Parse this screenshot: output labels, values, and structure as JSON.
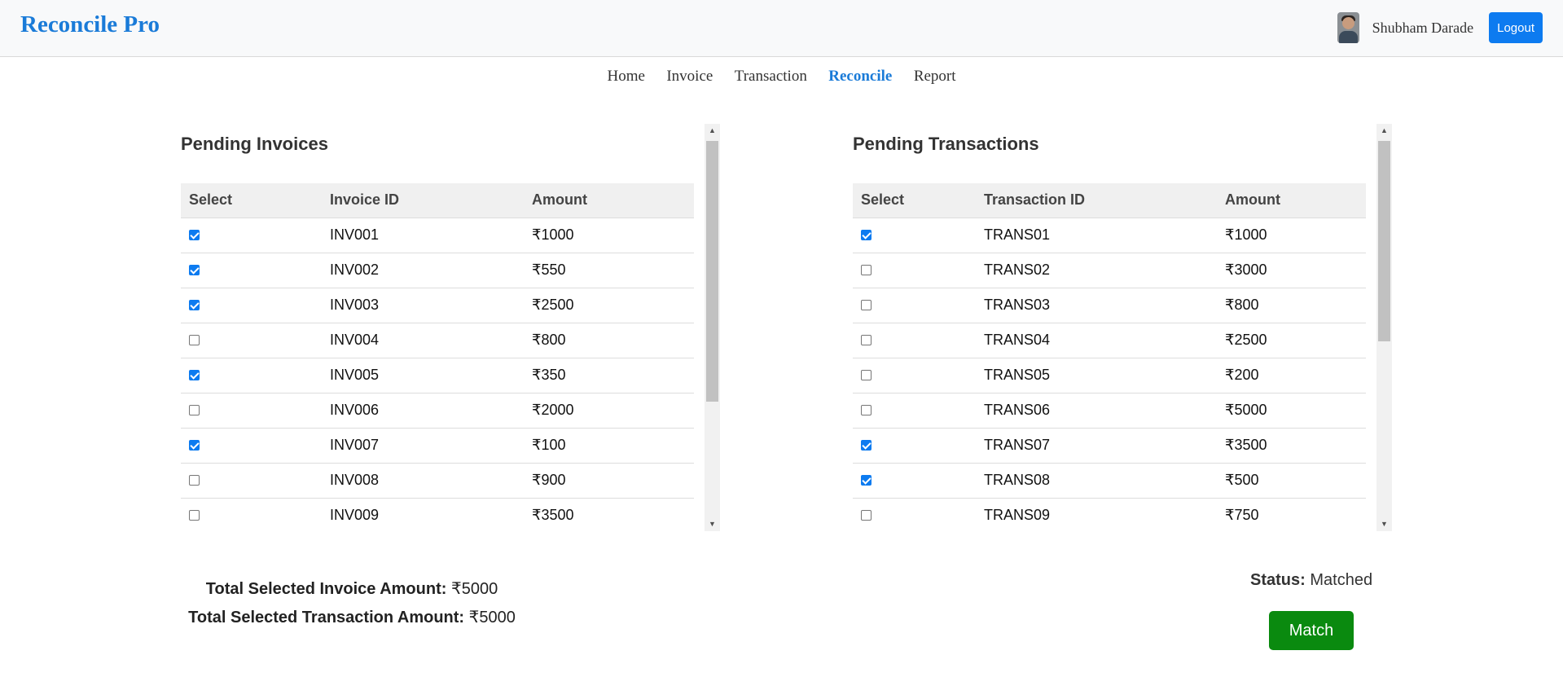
{
  "app": {
    "title": "Reconcile Pro"
  },
  "user": {
    "name": "Shubham Darade",
    "logout_label": "Logout"
  },
  "nav": {
    "items": [
      "Home",
      "Invoice",
      "Transaction",
      "Reconcile",
      "Report"
    ],
    "active": "Reconcile"
  },
  "invoices": {
    "title": "Pending Invoices",
    "columns": [
      "Select",
      "Invoice ID",
      "Amount"
    ],
    "rows": [
      {
        "checked": true,
        "id": "INV001",
        "amount": "₹1000"
      },
      {
        "checked": true,
        "id": "INV002",
        "amount": "₹550"
      },
      {
        "checked": true,
        "id": "INV003",
        "amount": "₹2500"
      },
      {
        "checked": false,
        "id": "INV004",
        "amount": "₹800"
      },
      {
        "checked": true,
        "id": "INV005",
        "amount": "₹350"
      },
      {
        "checked": false,
        "id": "INV006",
        "amount": "₹2000"
      },
      {
        "checked": true,
        "id": "INV007",
        "amount": "₹100"
      },
      {
        "checked": false,
        "id": "INV008",
        "amount": "₹900"
      },
      {
        "checked": false,
        "id": "INV009",
        "amount": "₹3500"
      }
    ]
  },
  "transactions": {
    "title": "Pending Transactions",
    "columns": [
      "Select",
      "Transaction ID",
      "Amount"
    ],
    "rows": [
      {
        "checked": true,
        "id": "TRANS01",
        "amount": "₹1000"
      },
      {
        "checked": false,
        "id": "TRANS02",
        "amount": "₹3000"
      },
      {
        "checked": false,
        "id": "TRANS03",
        "amount": "₹800"
      },
      {
        "checked": false,
        "id": "TRANS04",
        "amount": "₹2500"
      },
      {
        "checked": false,
        "id": "TRANS05",
        "amount": "₹200"
      },
      {
        "checked": false,
        "id": "TRANS06",
        "amount": "₹5000"
      },
      {
        "checked": true,
        "id": "TRANS07",
        "amount": "₹3500"
      },
      {
        "checked": true,
        "id": "TRANS08",
        "amount": "₹500"
      },
      {
        "checked": false,
        "id": "TRANS09",
        "amount": "₹750"
      }
    ]
  },
  "totals": {
    "invoice_label": "Total Selected Invoice Amount:",
    "invoice_value": "₹5000",
    "transaction_label": "Total Selected Transaction Amount:",
    "transaction_value": "₹5000"
  },
  "status": {
    "label": "Status:",
    "value": "Matched"
  },
  "match_label": "Match",
  "colors": {
    "brand": "#1a7bd8",
    "primary": "#0d7bf0",
    "match": "#0a8a0f"
  }
}
